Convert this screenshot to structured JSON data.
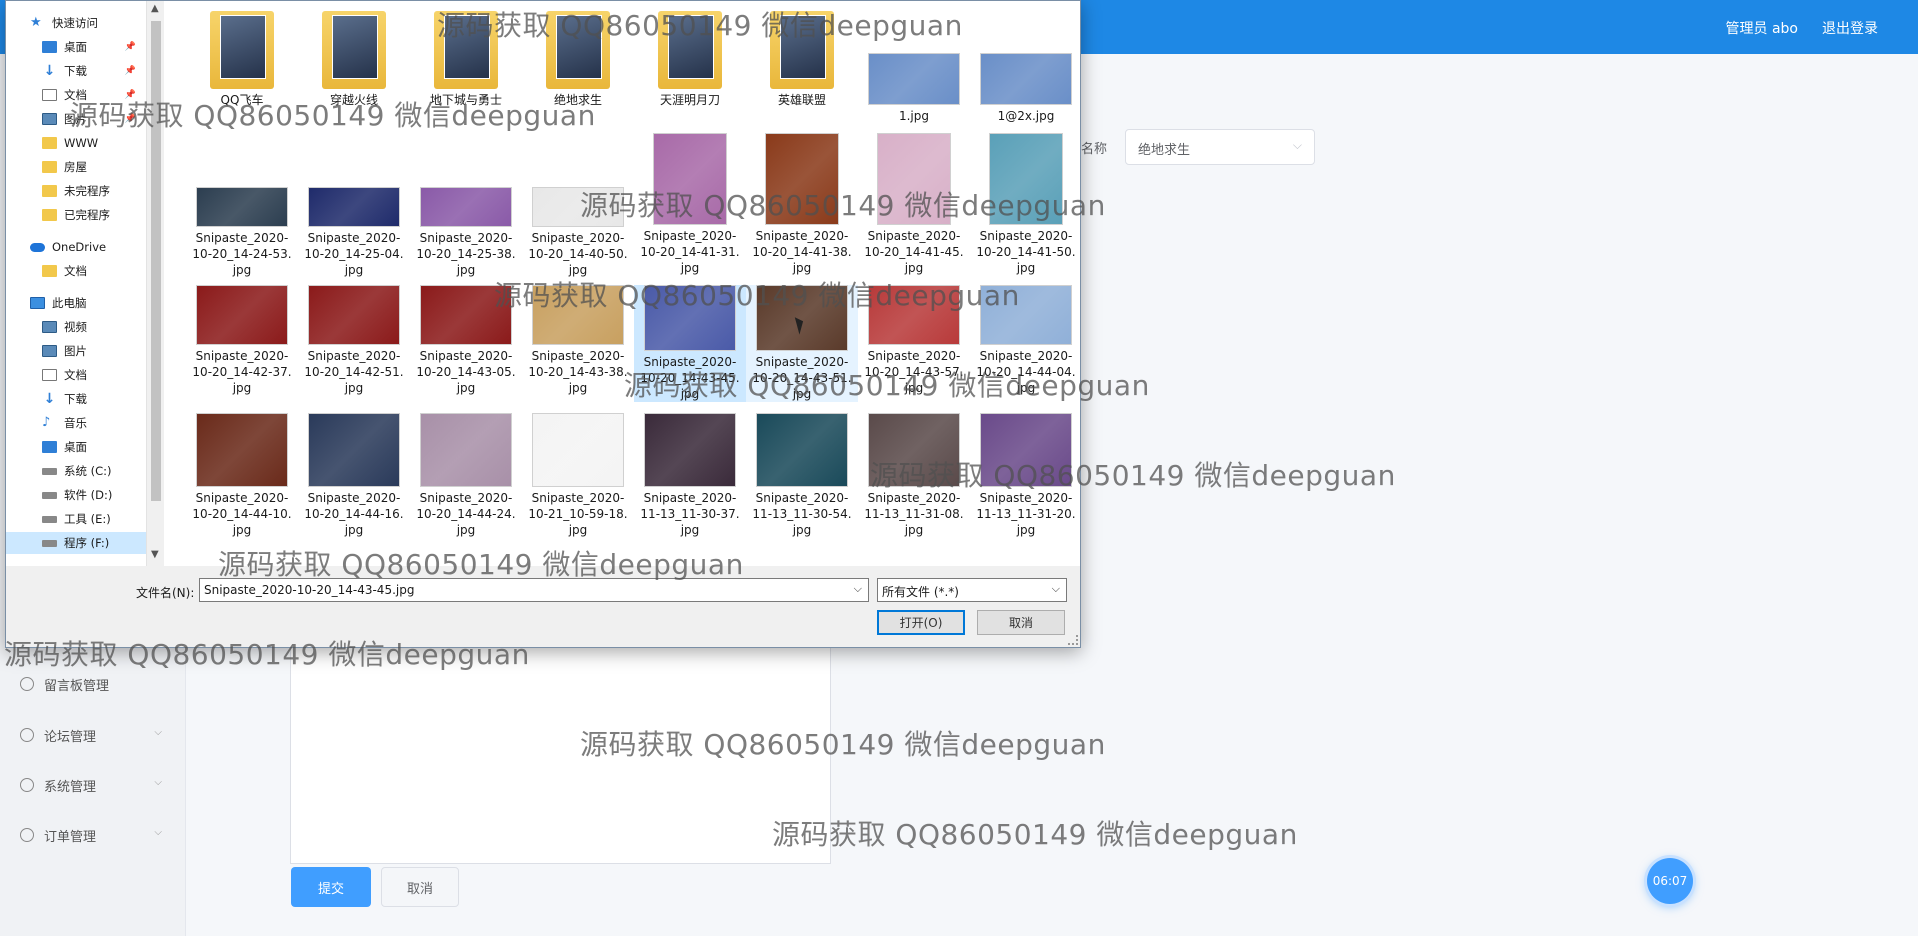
{
  "topbar": {
    "user": "管理员 abo",
    "logout": "退出登录"
  },
  "sidebar": [
    {
      "label": "留言板管理",
      "icon": "message-icon"
    },
    {
      "label": "论坛管理",
      "icon": "forum-icon"
    },
    {
      "label": "系统管理",
      "icon": "settings-icon"
    },
    {
      "label": "订单管理",
      "icon": "order-icon"
    }
  ],
  "form": {
    "game_label": "戏名称",
    "game_value": "绝地求生",
    "submit": "提交",
    "cancel": "取消"
  },
  "clock": "06:07",
  "dialog": {
    "nav": [
      {
        "label": "快速访问",
        "icon": "star-icon"
      },
      {
        "label": "桌面",
        "icon": "desktop-icon",
        "pinned": true
      },
      {
        "label": "下载",
        "icon": "download-icon",
        "pinned": true
      },
      {
        "label": "文档",
        "icon": "document-icon",
        "pinned": true
      },
      {
        "label": "图片",
        "icon": "pictures-icon",
        "pinned": true
      },
      {
        "label": "WWW",
        "icon": "folder-icon"
      },
      {
        "label": "房屋",
        "icon": "folder-icon"
      },
      {
        "label": "未完程序",
        "icon": "folder-icon"
      },
      {
        "label": "已完程序",
        "icon": "folder-icon"
      },
      {
        "label": "OneDrive",
        "icon": "cloud-icon"
      },
      {
        "label": "文档",
        "icon": "folder-icon"
      },
      {
        "label": "此电脑",
        "icon": "computer-icon"
      },
      {
        "label": "视频",
        "icon": "video-icon"
      },
      {
        "label": "图片",
        "icon": "pictures-icon"
      },
      {
        "label": "文档",
        "icon": "document-icon"
      },
      {
        "label": "下载",
        "icon": "download-icon"
      },
      {
        "label": "音乐",
        "icon": "music-icon"
      },
      {
        "label": "桌面",
        "icon": "desktop-icon"
      },
      {
        "label": "系统 (C:)",
        "icon": "drive-icon"
      },
      {
        "label": "软件 (D:)",
        "icon": "drive-icon"
      },
      {
        "label": "工具 (E:)",
        "icon": "drive-icon"
      },
      {
        "label": "程序 (F:)",
        "icon": "drive-icon",
        "selected": true
      }
    ],
    "files": [
      {
        "name": "QQ飞车",
        "kind": "folder",
        "color": "#5a7fb0"
      },
      {
        "name": "穿越火线",
        "kind": "folder",
        "color": "#7a6a4a"
      },
      {
        "name": "地下城与勇士",
        "kind": "folder",
        "color": "#2a2a3a"
      },
      {
        "name": "绝地求生",
        "kind": "folder",
        "color": "#1a1a1a"
      },
      {
        "name": "天涯明月刀",
        "kind": "folder",
        "color": "#7fb0e0"
      },
      {
        "name": "英雄联盟",
        "kind": "folder",
        "color": "#4a3a6a"
      },
      {
        "name": "1.jpg",
        "kind": "image",
        "color": "#6a8fc8"
      },
      {
        "name": "1@2x.jpg",
        "kind": "image",
        "color": "#6a8fc8"
      },
      {
        "name": "Snipaste_2020-10-20_14-24-53.jpg",
        "kind": "image",
        "color": "#2c3e50"
      },
      {
        "name": "Snipaste_2020-10-20_14-25-04.jpg",
        "kind": "image",
        "color": "#1f2b6b"
      },
      {
        "name": "Snipaste_2020-10-20_14-25-38.jpg",
        "kind": "image",
        "color": "#8a5aa8"
      },
      {
        "name": "Snipaste_2020-10-20_14-40-50.jpg",
        "kind": "image",
        "color": "#e8e8e8"
      },
      {
        "name": "Snipaste_2020-10-20_14-41-31.jpg",
        "kind": "image",
        "color": "#a86aa8"
      },
      {
        "name": "Snipaste_2020-10-20_14-41-38.jpg",
        "kind": "image",
        "color": "#8a3a1a"
      },
      {
        "name": "Snipaste_2020-10-20_14-41-45.jpg",
        "kind": "image",
        "color": "#d8b0c8"
      },
      {
        "name": "Snipaste_2020-10-20_14-41-50.jpg",
        "kind": "image",
        "color": "#5aa0b8"
      },
      {
        "name": "Snipaste_2020-10-20_14-42-37.jpg",
        "kind": "image",
        "color": "#8b1a1a"
      },
      {
        "name": "Snipaste_2020-10-20_14-42-51.jpg",
        "kind": "image",
        "color": "#8b1a1a"
      },
      {
        "name": "Snipaste_2020-10-20_14-43-05.jpg",
        "kind": "image",
        "color": "#8b1a1a"
      },
      {
        "name": "Snipaste_2020-10-20_14-43-38.jpg",
        "kind": "image",
        "color": "#c8a060"
      },
      {
        "name": "Snipaste_2020-10-20_14-43-45.jpg",
        "kind": "image",
        "color": "#4a5aa8",
        "selected": true
      },
      {
        "name": "Snipaste_2020-10-20_14-43-51.jpg",
        "kind": "image",
        "color": "#5a3a2a",
        "hover": true
      },
      {
        "name": "Snipaste_2020-10-20_14-43-57.jpg",
        "kind": "image",
        "color": "#b83a3a"
      },
      {
        "name": "Snipaste_2020-10-20_14-44-04.jpg",
        "kind": "image",
        "color": "#90b0d8"
      },
      {
        "name": "Snipaste_2020-10-20_14-44-10.jpg",
        "kind": "image",
        "color": "#6a2a1a"
      },
      {
        "name": "Snipaste_2020-10-20_14-44-16.jpg",
        "kind": "image",
        "color": "#2a3a5a"
      },
      {
        "name": "Snipaste_2020-10-20_14-44-24.jpg",
        "kind": "image",
        "color": "#a890a8"
      },
      {
        "name": "Snipaste_2020-10-21_10-59-18.jpg",
        "kind": "image",
        "color": "#f4f4f4"
      },
      {
        "name": "Snipaste_2020-11-13_11-30-37.jpg",
        "kind": "image",
        "color": "#3a2a3a"
      },
      {
        "name": "Snipaste_2020-11-13_11-30-54.jpg",
        "kind": "image",
        "color": "#1a4a5a"
      },
      {
        "name": "Snipaste_2020-11-13_11-31-08.jpg",
        "kind": "image",
        "color": "#5a4a4a"
      },
      {
        "name": "Snipaste_2020-11-13_11-31-20.jpg",
        "kind": "image",
        "color": "#6a4a8a"
      }
    ],
    "filename_label": "文件名(N):",
    "filename_value": "Snipaste_2020-10-20_14-43-45.jpg",
    "filetype": "所有文件 (*.*)",
    "open": "打开(O)",
    "cancel": "取消"
  },
  "watermark_text": "源码获取 QQ86050149 微信deepguan"
}
